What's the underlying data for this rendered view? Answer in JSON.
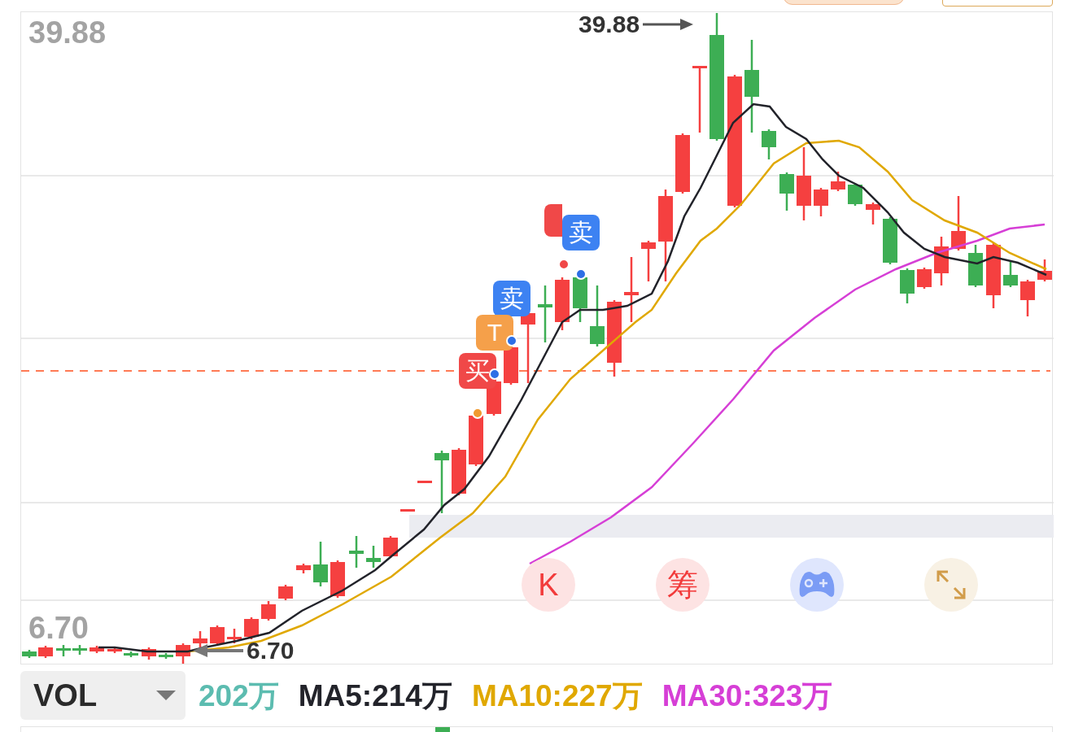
{
  "axis_labels": {
    "high": "39.88",
    "low": "6.70"
  },
  "extreme_marks": [
    {
      "kind": "high",
      "label": "39.88"
    },
    {
      "kind": "low",
      "label": "6.70"
    }
  ],
  "signals": [
    {
      "kind": "buy"
    },
    {
      "kind": "sell",
      "label": "卖"
    },
    {
      "kind": "sell",
      "label": "卖"
    },
    {
      "kind": "t",
      "label": "T"
    },
    {
      "kind": "buy",
      "label": "买"
    }
  ],
  "tools": [
    {
      "kind": "text",
      "label": "K",
      "color": "#f23b3b"
    },
    {
      "kind": "text",
      "label": "筹",
      "color": "#f23b3b"
    },
    {
      "kind": "gamepad",
      "color": "#7b9cf5"
    },
    {
      "kind": "expand",
      "color": "#d19c4a"
    }
  ],
  "indicator": {
    "name": "VOL",
    "values": [
      {
        "label": "202万",
        "color": "#5cbcb0"
      },
      {
        "label": "MA5:214万",
        "color": "#22232a"
      },
      {
        "label": "MA10:227万",
        "color": "#e0a800"
      },
      {
        "label": "MA30:323万",
        "color": "#d63fd6"
      }
    ]
  }
}
